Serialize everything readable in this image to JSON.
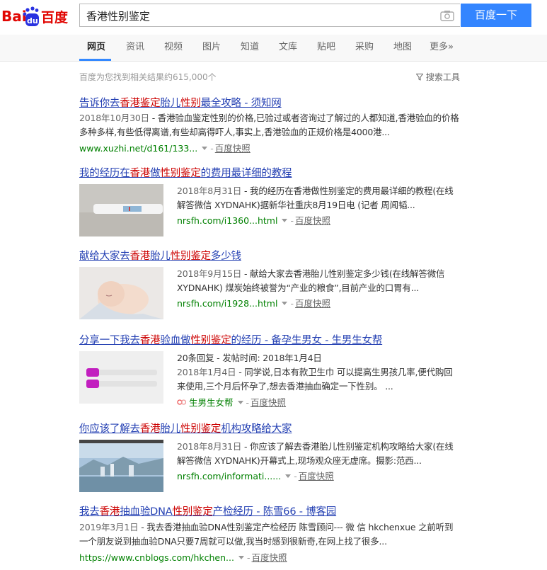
{
  "header": {
    "logo_text_left": "Bai",
    "logo_text_mid": "du",
    "logo_text_right": "百度",
    "search_value": "香港性别鉴定",
    "search_button": "百度一下"
  },
  "nav": {
    "tabs": [
      "网页",
      "资讯",
      "视频",
      "图片",
      "知道",
      "文库",
      "贴吧",
      "采购",
      "地图",
      "更多»"
    ]
  },
  "stats": {
    "text": "百度为您找到相关结果约615,000个",
    "tools": "搜索工具"
  },
  "results": [
    {
      "title_parts": [
        "告诉你去",
        "香港鉴定",
        "胎儿",
        "性别",
        "最全攻略 - 须知网"
      ],
      "snippet_date": "2018年10月30日",
      "snippet": " - 香港验血鉴定性别的价格,已验过或者咨询过了解过的人都知道,香港验血的价格多种多样,有些低得离谱,有些却高得吓人,事实上,香港验血的正规价格是4000港...",
      "url": "www.xuzhi.net/d161/133...",
      "snapshot": "百度快照"
    },
    {
      "title_parts": [
        "我的经历在",
        "香港",
        "做",
        "性别鉴定",
        "的费用最详细的教程"
      ],
      "snippet_date": "2018年8月31日",
      "snippet": " - 我的经历在香港做性别鉴定的费用最详细的教程(在线解答微信 XYDNAHK)据新华社重庆8月19日电 (记者 周闻韬...",
      "url": "nrsfh.com/i1360...html",
      "snapshot": "百度快照"
    },
    {
      "title_parts": [
        "献给大家去",
        "香港",
        "胎儿",
        "性别鉴定",
        "多少钱"
      ],
      "snippet_date": "2018年9月15日",
      "snippet": " - 献给大家去香港胎儿性别鉴定多少钱(在线解答微信 XYDNAHK) 煤炭始终被誉为“产业的粮食”,目前产业的口胃有...",
      "url": "nrsfh.com/i1928...html",
      "snapshot": "百度快照"
    },
    {
      "title_parts": [
        "分享一下我去",
        "香港",
        "验血做",
        "性别鉴定",
        "的经历 - 备孕生男女 - 生男生女帮"
      ],
      "meta": "20条回复 - 发帖时间: 2018年1月4日",
      "snippet_date": "2018年1月4日",
      "snippet": " - 同学说,日本有款卫生巾 可以提高生男孩几率,便代购回来使用,三个月后怀孕了,想去香港抽血确定一下性别。 ...",
      "url": "生男生女帮",
      "snapshot": "百度快照"
    },
    {
      "title_parts": [
        "你应该了解去",
        "香港",
        "胎儿",
        "性别鉴定",
        "机构攻略给大家"
      ],
      "snippet_date": "2018年8月31日",
      "snippet": " - 你应该了解去香港胎儿性别鉴定机构攻略给大家(在线解答微信 XYDNAHK)开幕式上,现场观众座无虚席。摄影:范西...",
      "url": "nrsfh.com/informati......",
      "snapshot": "百度快照"
    },
    {
      "title_parts": [
        "我去",
        "香港",
        "抽血验DNA",
        "性别鉴定",
        "产检经历 - 陈雪66 - 博客园"
      ],
      "snippet_date": "2019年3月1日",
      "snippet": " - 我去香港抽血验DNA性别鉴定产检经历 陈雪顾问--- 微 信 hkchenxue 之前听到一个朋友说到抽血验DNA只要7周就可以做,我当时感到很新奇,在网上找了很多...",
      "url": "https://www.cnblogs.com/hkchen...",
      "snapshot": "百度快照"
    }
  ],
  "colors": {
    "link": "#2440b3",
    "highlight": "#c00",
    "url": "#008000",
    "button": "#3385ff"
  }
}
